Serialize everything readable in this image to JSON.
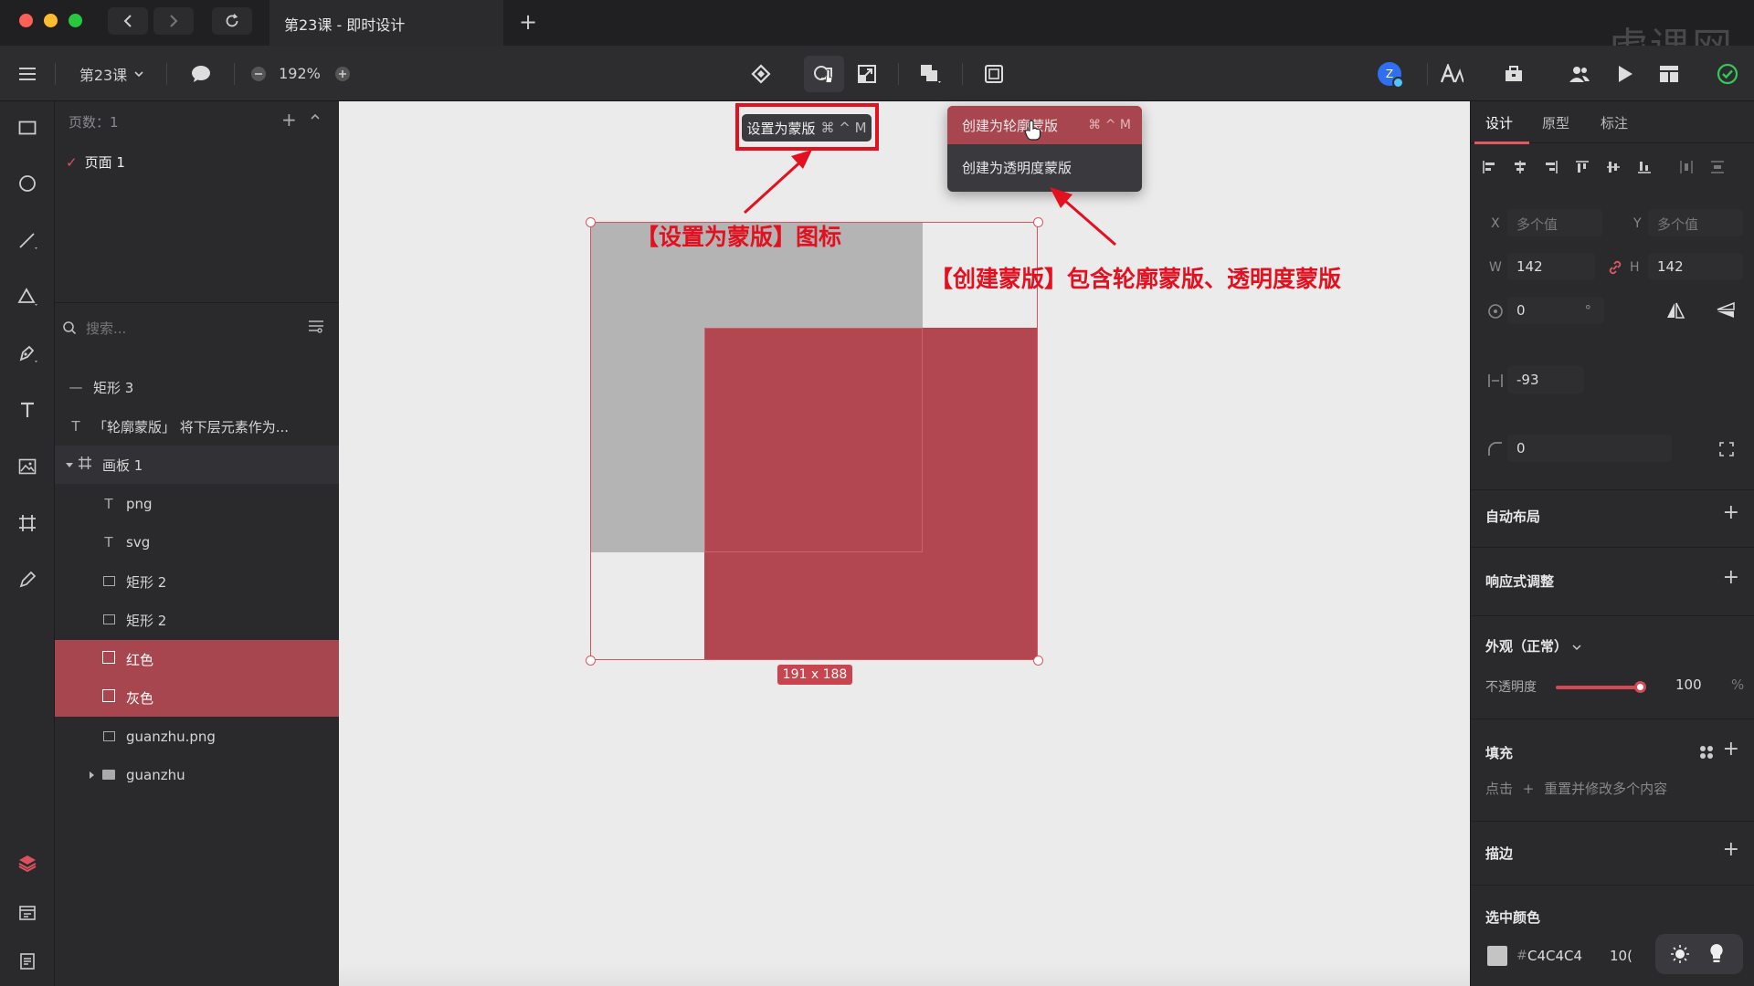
{
  "window": {
    "tab_title": "第23课 - 即时设计",
    "new_tab": "+",
    "watermark": "虎课网"
  },
  "toolbar": {
    "file_menu": "第23课",
    "zoom": "192%",
    "avatar_initial": "Z"
  },
  "layers_panel": {
    "pages_header": "页数：1",
    "page_name": "页面 1",
    "search_placeholder": "搜索...",
    "items": [
      {
        "label": "矩形 3",
        "type": "line"
      },
      {
        "label": "「轮廓蒙版」 将下层元素作为...",
        "type": "text"
      },
      {
        "label": "画板 1",
        "type": "board"
      },
      {
        "label": "png",
        "type": "text"
      },
      {
        "label": "svg",
        "type": "text"
      },
      {
        "label": "矩形 2",
        "type": "image"
      },
      {
        "label": "矩形 2",
        "type": "image"
      },
      {
        "label": "红色",
        "type": "rect",
        "selected": true
      },
      {
        "label": "灰色",
        "type": "rect",
        "selected": true
      },
      {
        "label": "guanzhu.png",
        "type": "image"
      },
      {
        "label": "guanzhu",
        "type": "folder"
      }
    ]
  },
  "canvas": {
    "tooltip": {
      "label": "设置为蒙版",
      "shortcut": "⌘ ^ M"
    },
    "menu": [
      {
        "label": "创建为轮廓蒙版",
        "shortcut": "⌘ ^ M"
      },
      {
        "label": "创建为透明度蒙版",
        "shortcut": ""
      }
    ],
    "annotation_left": "【设置为蒙版】图标",
    "annotation_right": "【创建蒙版】包含轮廓蒙版、透明度蒙版",
    "size_badge": "191 x 188"
  },
  "inspector": {
    "tabs": [
      "设计",
      "原型",
      "标注"
    ],
    "x_label": "X",
    "x_placeholder": "多个值",
    "y_label": "Y",
    "y_placeholder": "多个值",
    "w_label": "W",
    "w_value": "142",
    "h_label": "H",
    "h_value": "142",
    "rotation_value": "0",
    "rotation_unit": "°",
    "spacing_value": "-93",
    "radius_value": "0",
    "auto_layout": "自动布局",
    "responsive": "响应式调整",
    "appearance": "外观（正常）",
    "opacity_label": "不透明度",
    "opacity_value": "100",
    "opacity_unit": "%",
    "opacity_level": 1.0,
    "fill": "填充",
    "fill_hint_a": "点击",
    "fill_hint_b": "重置并修改多个内容",
    "stroke": "描边",
    "selected_colors": "选中颜色",
    "color_hash": "#",
    "color_hex": "C4C4C4",
    "color_opacity_partial": "10("
  },
  "colors": {
    "accent": "#a8464f",
    "red_shape": "#b24651",
    "gray_shape": "#b4b4b4",
    "annotation": "#e3101f"
  }
}
